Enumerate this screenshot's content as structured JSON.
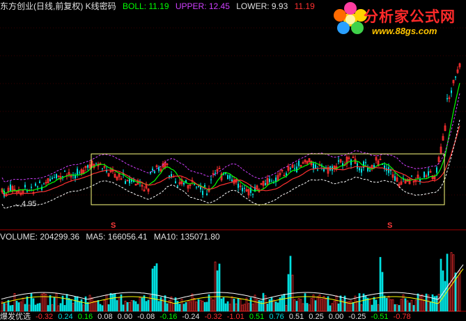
{
  "header": {
    "title": "东方创业(日线,前复权) K线密码",
    "boll_label": "BOLL: 11.19",
    "upper_label": "UPPER: 12.45",
    "lower_label": "LOWER: 9.93",
    "price_label": "11.19"
  },
  "price_chart": {
    "low_marker": "←4.95"
  },
  "volume": {
    "volume_label": "VOLUME: 204299.36",
    "ma5_label": "MA5: 166056.41",
    "ma10_label": "MA10: 135071.80"
  },
  "signal_markers": [
    "S",
    "S"
  ],
  "footer": {
    "title": "爆发优选",
    "values": [
      "-0.32",
      "0.24",
      "0.16",
      "0.08",
      "0.00",
      "-0.08",
      "-0.16",
      "-0.24",
      "-0.32",
      "-1.01",
      "0.51",
      "0.76",
      "0.51",
      "0.25",
      "0.00",
      "-0.25",
      "-0.51",
      "-0.78"
    ]
  },
  "logo": {
    "text": "分析家公式网",
    "url": "www.88gs.com"
  },
  "colors": {
    "background": "#000000",
    "up_candle": "#ff3030",
    "down_candle": "#00e0e0",
    "boll_mid": "#ff3030",
    "boll_band": "#ffffff",
    "ma_line": "#00ff00",
    "frame": "#ffff80",
    "header_green": "#00ff00",
    "header_purple": "#d040ff"
  }
}
